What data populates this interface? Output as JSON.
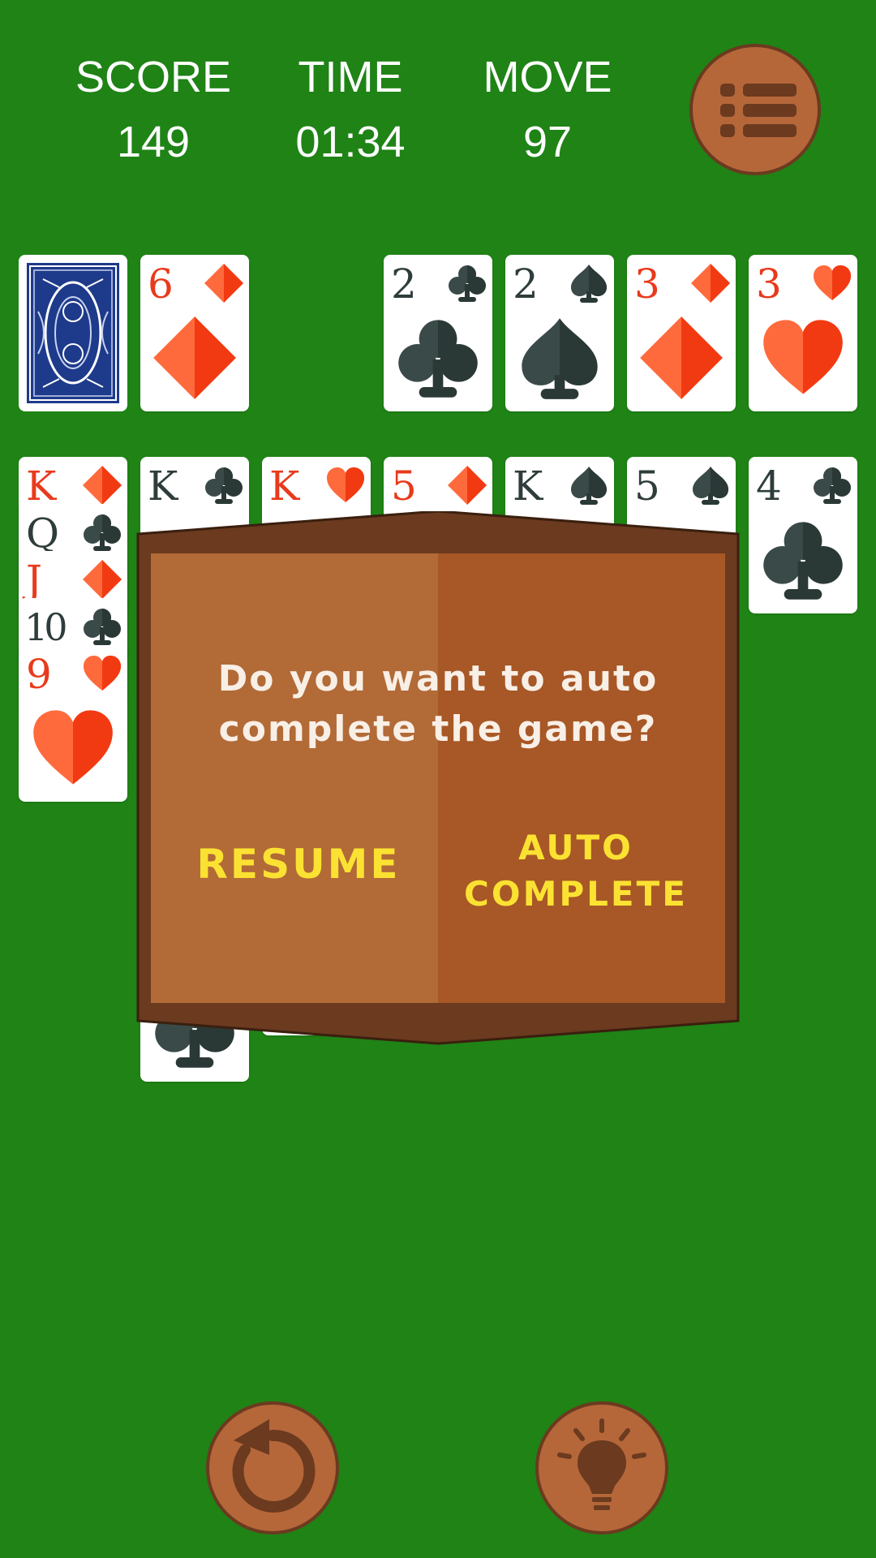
{
  "header": {
    "score_label": "SCORE",
    "score_value": "149",
    "time_label": "TIME",
    "time_value": "01:34",
    "move_label": "MOVE",
    "move_value": "97",
    "menu_icon": "menu-list-icon"
  },
  "stock": {
    "face_down": true
  },
  "waste": {
    "rank": "6",
    "suit": "diamonds"
  },
  "foundations": [
    {
      "rank": "2",
      "suit": "clubs"
    },
    {
      "rank": "2",
      "suit": "spades"
    },
    {
      "rank": "3",
      "suit": "diamonds"
    },
    {
      "rank": "3",
      "suit": "hearts"
    }
  ],
  "tableau": {
    "col1": [
      {
        "rank": "K",
        "suit": "diamonds"
      },
      {
        "rank": "Q",
        "suit": "clubs"
      },
      {
        "rank": "J",
        "suit": "diamonds"
      },
      {
        "rank": "10",
        "suit": "clubs"
      },
      {
        "rank": "9",
        "suit": "hearts"
      }
    ],
    "col2_top": {
      "rank": "K",
      "suit": "clubs"
    },
    "col3_top": {
      "rank": "K",
      "suit": "hearts"
    },
    "col4_top": {
      "rank": "5",
      "suit": "diamonds"
    },
    "col5_top": {
      "rank": "K",
      "suit": "spades"
    },
    "col6_top": {
      "rank": "5",
      "suit": "spades"
    },
    "col7": {
      "rank": "4",
      "suit": "clubs"
    }
  },
  "dialog": {
    "question_line1": "Do you want to auto",
    "question_line2": "complete the game?",
    "resume_label": "RESUME",
    "auto_line1": "AUTO",
    "auto_line2": "COMPLETE"
  },
  "bottom": {
    "undo_icon": "undo-icon",
    "hint_icon": "lightbulb-hint-icon"
  },
  "colors": {
    "table_green": "#1f8316",
    "wood": "#b5673a",
    "wood_dark": "#6b3a1f",
    "red_suit": "#e83a1c",
    "dark_suit": "#2e3d3b",
    "button_text": "#fbe232"
  }
}
